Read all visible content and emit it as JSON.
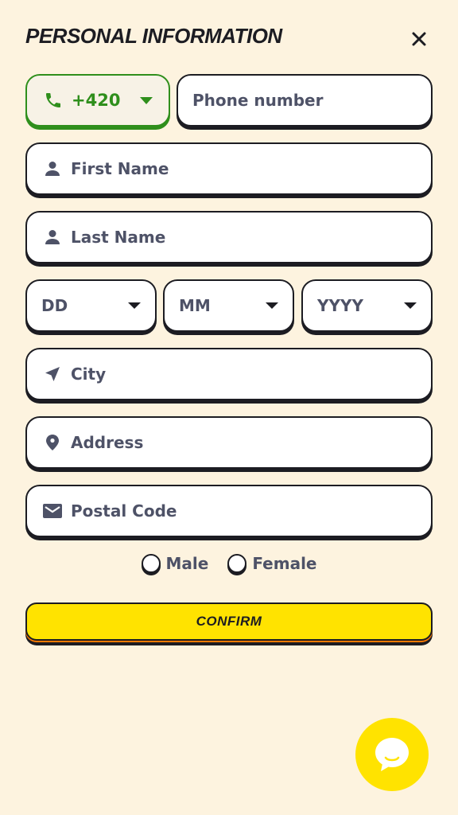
{
  "header": {
    "title": "PERSONAL INFORMATION",
    "close_icon": "close-icon"
  },
  "phone": {
    "country_code": "+420",
    "placeholder": "Phone number"
  },
  "fields": {
    "first_name": "First Name",
    "last_name": "Last Name",
    "city": "City",
    "address": "Address",
    "postal_code": "Postal Code"
  },
  "dob": {
    "day": "DD",
    "month": "MM",
    "year": "YYYY"
  },
  "gender": {
    "male": "Male",
    "female": "Female"
  },
  "confirm_label": "CONFIRM",
  "colors": {
    "background": "#fdf3df",
    "accent_yellow": "#ffe300",
    "country_green": "#2f8f1c",
    "dark": "#1c1c22",
    "muted_text": "#4e5267"
  }
}
